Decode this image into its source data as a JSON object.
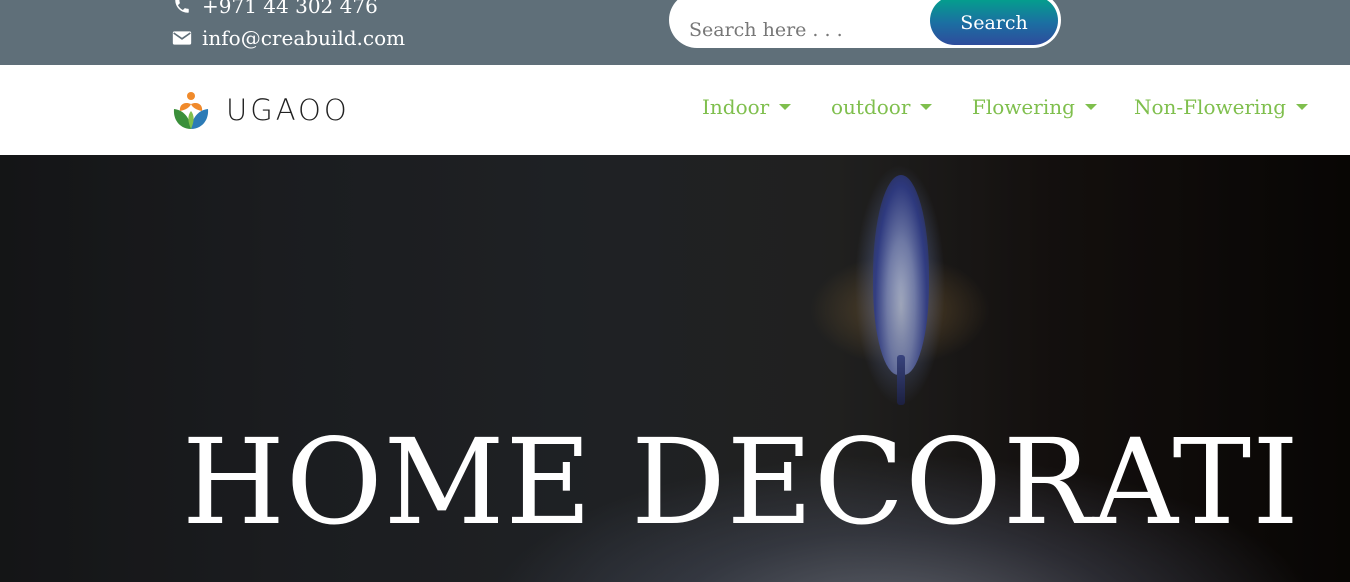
{
  "contact": {
    "phone": "+971 44 302 476",
    "email": "info@creabuild.com"
  },
  "search": {
    "placeholder": "Search here . . .",
    "button_label": "Search"
  },
  "brand": {
    "name": "UGAOO"
  },
  "nav": {
    "items": [
      {
        "label": "Indoor"
      },
      {
        "label": "outdoor"
      },
      {
        "label": "Flowering"
      },
      {
        "label": "Non-Flowering"
      }
    ]
  },
  "hero": {
    "title": "HOME DECORATI"
  },
  "colors": {
    "topbar": "#5f6f79",
    "nav_link": "#7fbf4d",
    "search_button_start": "#00a58a",
    "search_button_end": "#2e4c9c"
  }
}
